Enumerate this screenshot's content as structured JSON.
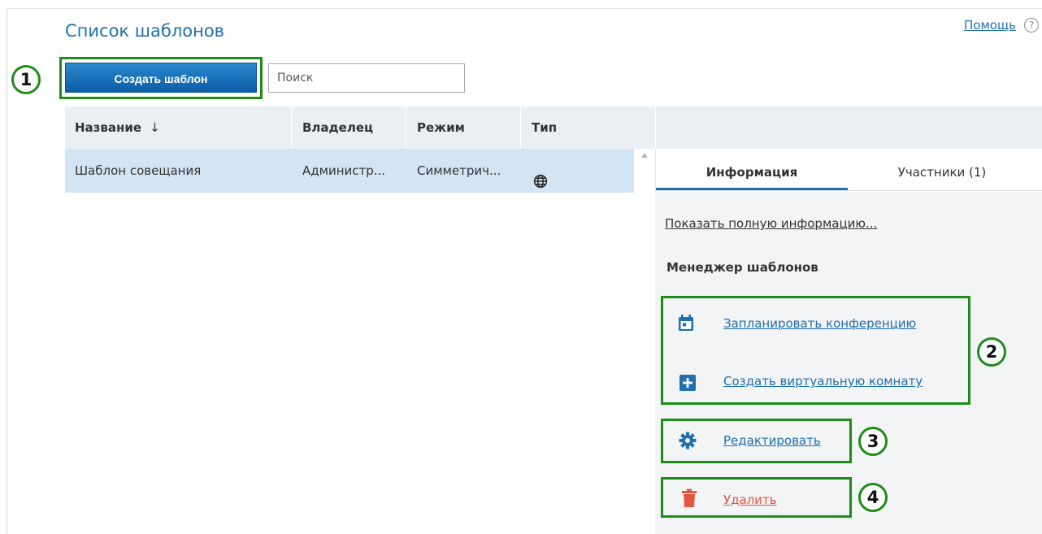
{
  "header": {
    "title": "Список шаблонов",
    "help_label": "Помощь",
    "help_icon": "question-circle-icon"
  },
  "toolbar": {
    "create_label": "Создать шаблон",
    "search_placeholder": "Поиск",
    "search_value": ""
  },
  "table": {
    "columns": [
      "Название",
      "Владелец",
      "Режим",
      "Тип"
    ],
    "sort_column": "Название",
    "sort_direction": "descending",
    "rows": [
      {
        "name": "Шаблон совещания",
        "owner": "Администр...",
        "mode": "Симметрич...",
        "type_icon": "globe-icon"
      }
    ]
  },
  "details": {
    "tabs": [
      "Информация",
      "Участники (1)"
    ],
    "active_tab": "Информация",
    "full_info_link": "Показать полную информацию...",
    "section_title": "Менеджер шаблонов",
    "actions": [
      {
        "label": "Запланировать конференцию",
        "icon": "calendar-icon"
      },
      {
        "label": "Создать виртуальную комнату",
        "icon": "plus-square-icon"
      },
      {
        "label": "Редактировать",
        "icon": "gear-icon"
      },
      {
        "label": "Удалить",
        "icon": "trash-icon"
      }
    ]
  },
  "annotations": [
    "1",
    "2",
    "3",
    "4"
  ],
  "colors": {
    "accent": "#1f6fb1",
    "highlight": "#1e8c16",
    "delete": "#e2553f",
    "selected_row": "#d3e4f3",
    "header_bg": "#eaeff3"
  }
}
